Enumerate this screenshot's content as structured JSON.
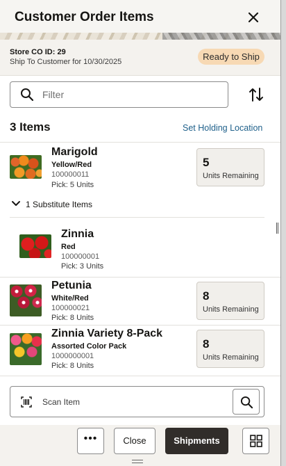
{
  "header": {
    "title": "Customer Order Items",
    "close_icon": "close-icon",
    "store_co_id": "Store CO ID: 29",
    "ship_to": "Ship To Customer for 10/30/2025",
    "status_badge": "Ready to Ship",
    "status_badge_color": "#f7d9b4"
  },
  "filter": {
    "placeholder": "Filter",
    "search_icon": "search-icon",
    "sort_icon": "sort-icon"
  },
  "summary": {
    "count_label": "3 Items",
    "holding_link": "Set Holding Location",
    "link_color": "#20618b"
  },
  "items": [
    {
      "name": "Marigold",
      "variant": "Yellow/Red",
      "sku": "100000011",
      "pick": "Pick: 5 Units",
      "units_remaining": "5",
      "units_label": "Units Remaining",
      "substitute_toggle": "1 Substitute Items",
      "substitute": {
        "name": "Zinnia",
        "variant": "Red",
        "sku": "100000001",
        "pick": "Pick: 3 Units"
      }
    },
    {
      "name": "Petunia",
      "variant": "White/Red",
      "sku": "100000021",
      "pick": "Pick: 8 Units",
      "units_remaining": "8",
      "units_label": "Units Remaining"
    },
    {
      "name": "Zinnia Variety 8-Pack",
      "variant": "Assorted Color Pack",
      "sku": "1000000001",
      "pick": "Pick: 8 Units",
      "units_remaining": "8",
      "units_label": "Units Remaining"
    }
  ],
  "scan": {
    "placeholder": "Scan Item",
    "barcode_icon": "barcode-icon",
    "search_icon": "search-icon"
  },
  "footer": {
    "more_label": "•••",
    "close_label": "Close",
    "primary_label": "Shipments",
    "primary_color": "#312d2a",
    "grid_icon": "grid-icon"
  }
}
